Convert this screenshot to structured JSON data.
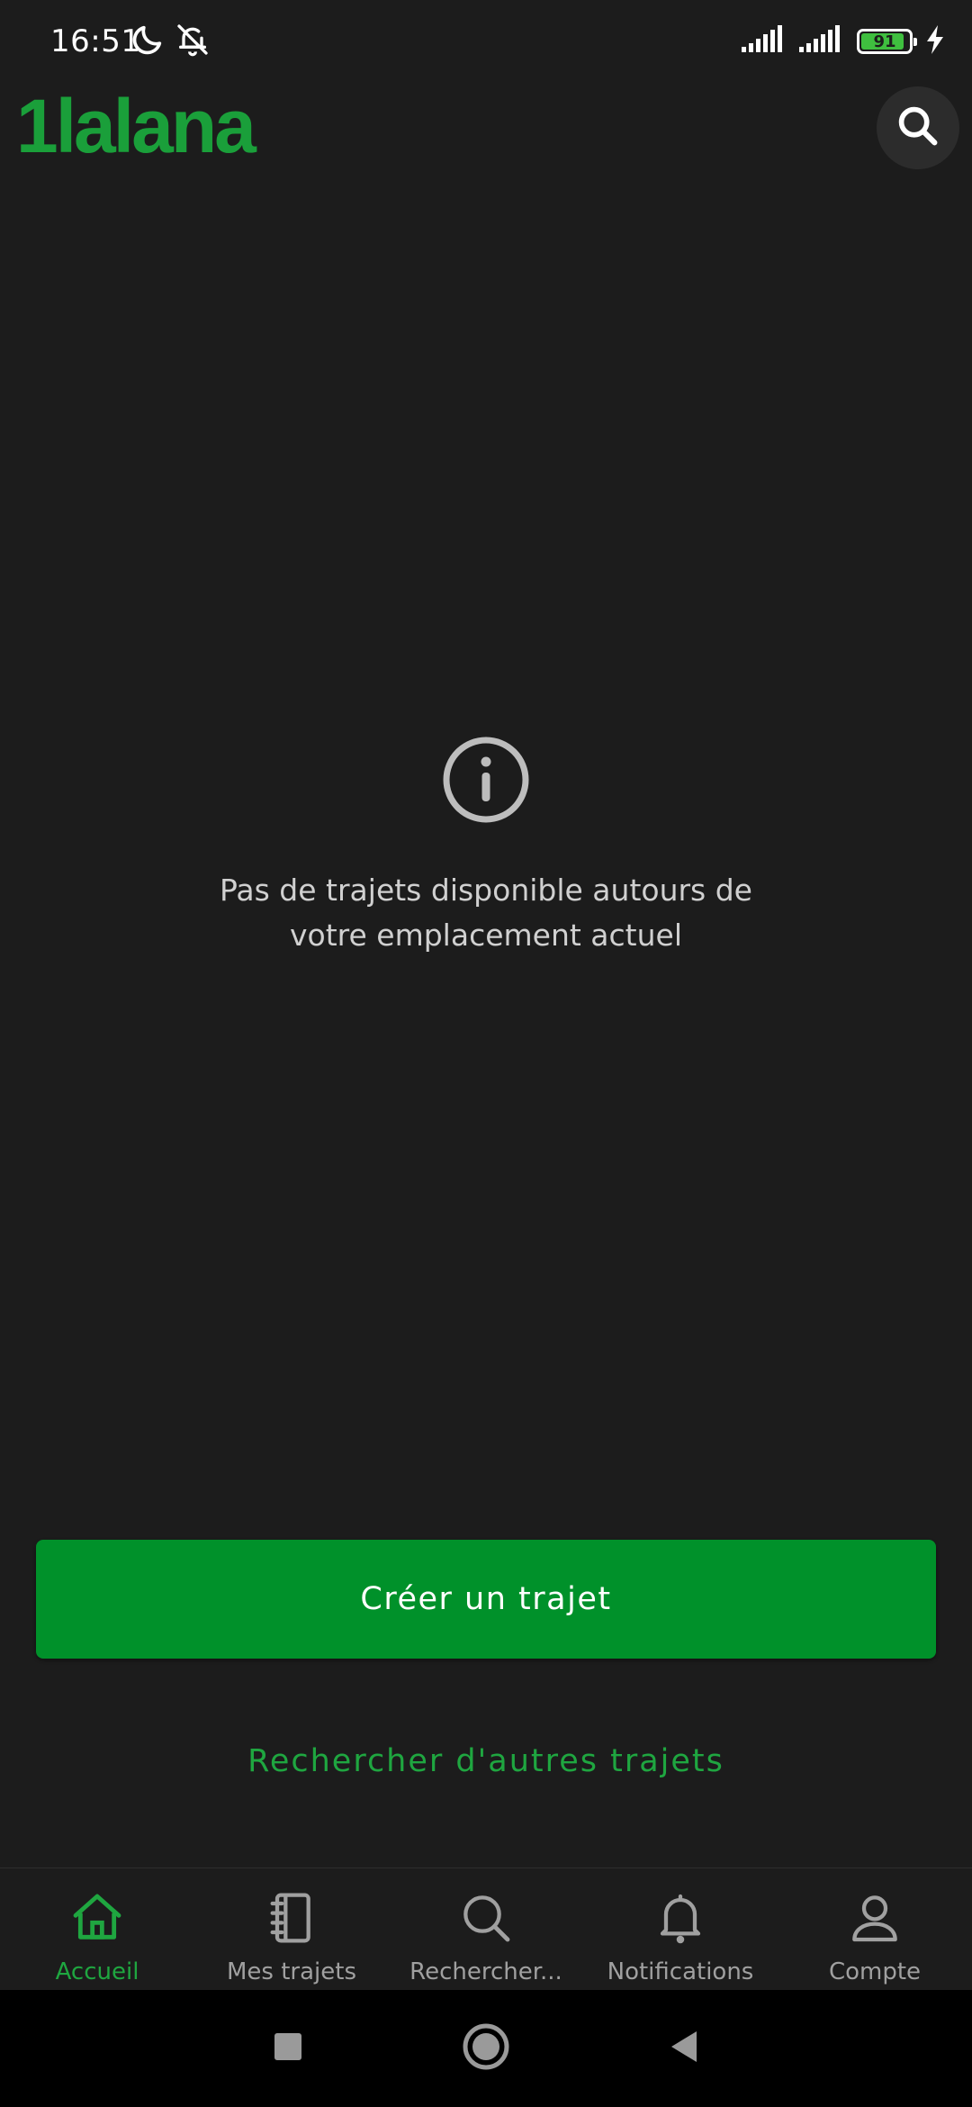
{
  "status_bar": {
    "time": "16:51",
    "battery_level": 91,
    "battery_text": "91",
    "icons": [
      "moon-icon",
      "bell-off-icon",
      "signal-icon",
      "signal-icon",
      "battery-icon",
      "charging-icon"
    ]
  },
  "header": {
    "logo_text": "1lalana",
    "search_icon": "search-icon"
  },
  "empty_state": {
    "icon": "info-icon",
    "message_line1": "Pas de trajets disponible autours de",
    "message_line2": "votre emplacement actuel"
  },
  "actions": {
    "create_label": "Créer un trajet",
    "search_others_label": "Rechercher d'autres trajets"
  },
  "bottom_nav": {
    "items": [
      {
        "label": "Accueil",
        "icon": "home-icon",
        "active": true
      },
      {
        "label": "Mes trajets",
        "icon": "notebook-icon",
        "active": false
      },
      {
        "label": "Rechercher...",
        "icon": "search-icon",
        "active": false
      },
      {
        "label": "Notifications",
        "icon": "bell-icon",
        "active": false
      },
      {
        "label": "Compte",
        "icon": "user-icon",
        "active": false
      }
    ]
  },
  "system_nav": {
    "buttons": [
      "recents-icon",
      "home-circle-icon",
      "back-icon"
    ]
  },
  "colors": {
    "background": "#1c1c1c",
    "brand_green": "#1a9f3a",
    "button_green": "#00912a",
    "inactive_gray": "#a0a0a0"
  }
}
